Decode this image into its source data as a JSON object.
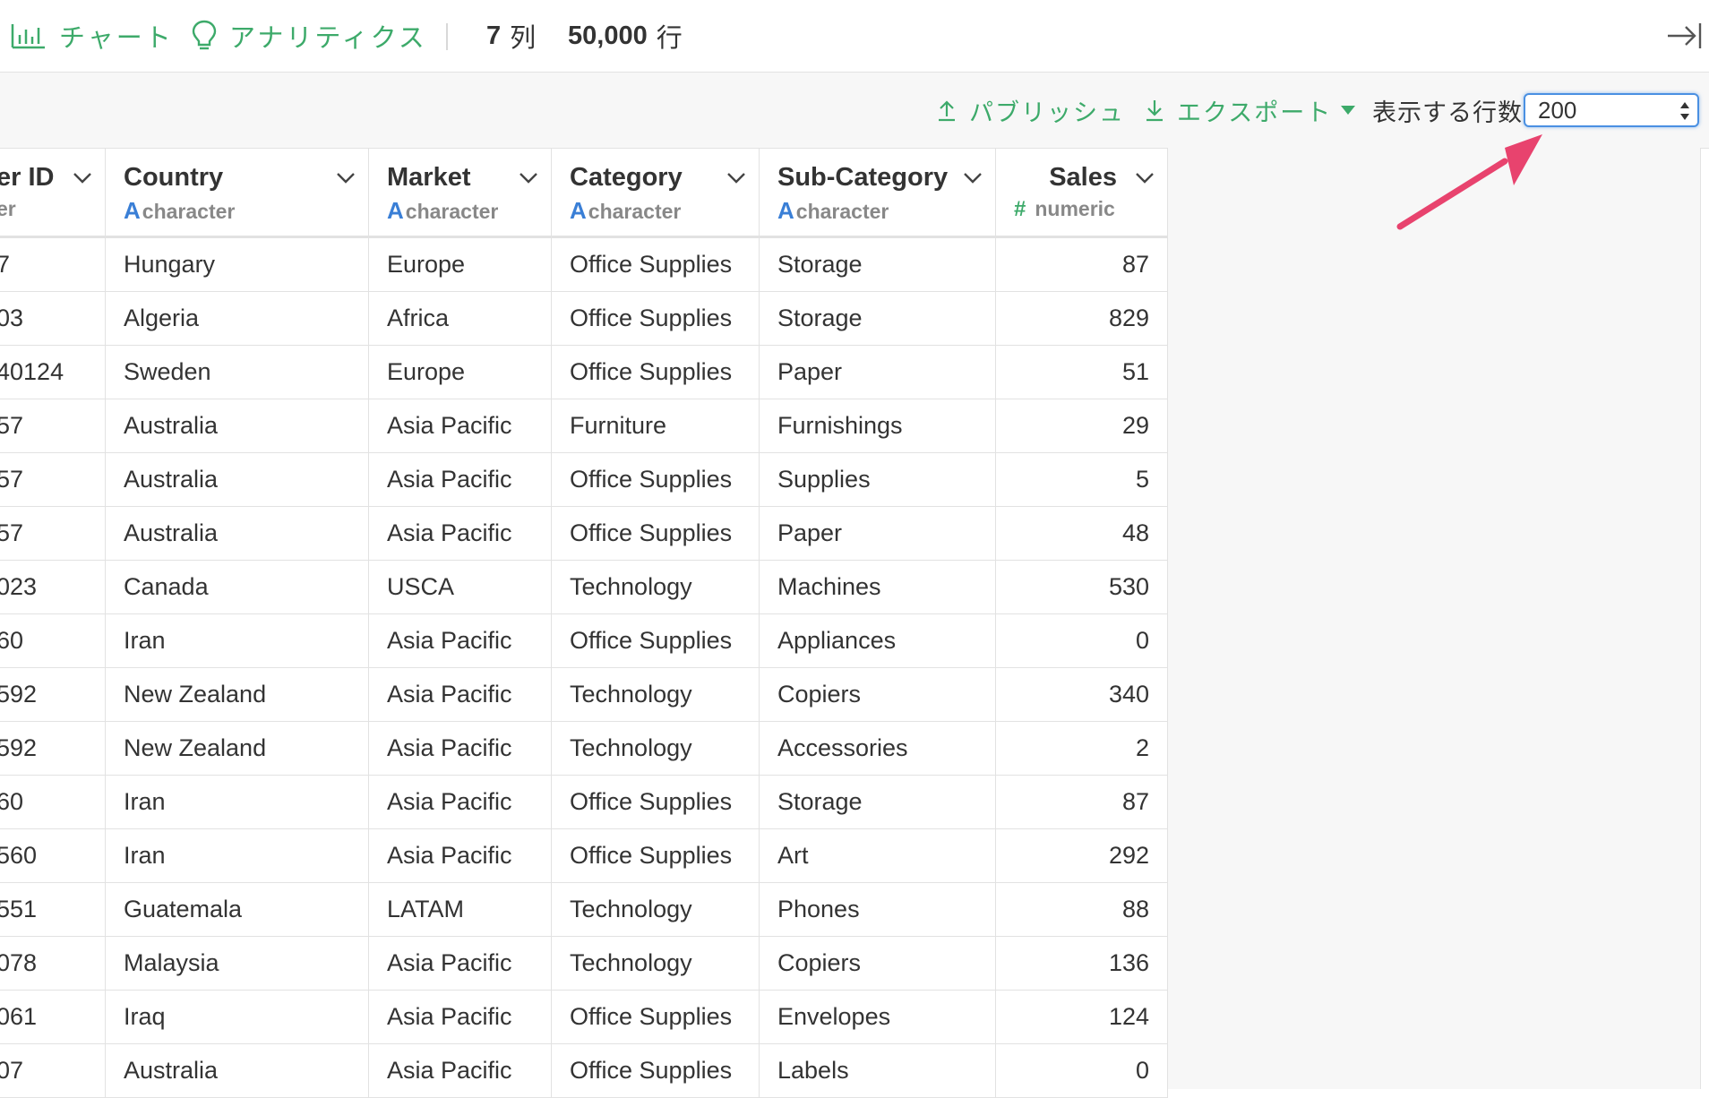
{
  "toolbar": {
    "chart_label": "チャート",
    "analytics_label": "アナリティクス",
    "columns_count": "7",
    "columns_unit": "列",
    "rows_count": "50,000",
    "rows_unit": "行"
  },
  "subbar": {
    "publish_label": "パブリッシュ",
    "export_label": "エクスポート",
    "rows_display_label": "表示する行数",
    "rows_display_value": "200"
  },
  "colors": {
    "accent_green": "#3daa6a",
    "type_blue": "#3a7fd6",
    "arrow_pink": "#e8436e",
    "focus_blue": "#4a90e2"
  },
  "columns": [
    {
      "name": "er ID",
      "type": "er"
    },
    {
      "name": "Country",
      "type_icon": "A",
      "type": "character"
    },
    {
      "name": "Market",
      "type_icon": "A",
      "type": "character"
    },
    {
      "name": "Category",
      "type_icon": "A",
      "type": "character"
    },
    {
      "name": "Sub-Category",
      "type_icon": "A",
      "type": "character"
    },
    {
      "name": "Sales",
      "type_icon": "#",
      "type": "numeric"
    }
  ],
  "rows": [
    [
      "7",
      "Hungary",
      "Europe",
      "Office Supplies",
      "Storage",
      "87"
    ],
    [
      "03",
      "Algeria",
      "Africa",
      "Office Supplies",
      "Storage",
      "829"
    ],
    [
      "40124",
      "Sweden",
      "Europe",
      "Office Supplies",
      "Paper",
      "51"
    ],
    [
      "57",
      "Australia",
      "Asia Pacific",
      "Furniture",
      "Furnishings",
      "29"
    ],
    [
      "57",
      "Australia",
      "Asia Pacific",
      "Office Supplies",
      "Supplies",
      "5"
    ],
    [
      "57",
      "Australia",
      "Asia Pacific",
      "Office Supplies",
      "Paper",
      "48"
    ],
    [
      "023",
      "Canada",
      "USCA",
      "Technology",
      "Machines",
      "530"
    ],
    [
      "60",
      "Iran",
      "Asia Pacific",
      "Office Supplies",
      "Appliances",
      "0"
    ],
    [
      "592",
      "New Zealand",
      "Asia Pacific",
      "Technology",
      "Copiers",
      "340"
    ],
    [
      "592",
      "New Zealand",
      "Asia Pacific",
      "Technology",
      "Accessories",
      "2"
    ],
    [
      "60",
      "Iran",
      "Asia Pacific",
      "Office Supplies",
      "Storage",
      "87"
    ],
    [
      "560",
      "Iran",
      "Asia Pacific",
      "Office Supplies",
      "Art",
      "292"
    ],
    [
      "551",
      "Guatemala",
      "LATAM",
      "Technology",
      "Phones",
      "88"
    ],
    [
      "078",
      "Malaysia",
      "Asia Pacific",
      "Technology",
      "Copiers",
      "136"
    ],
    [
      "061",
      "Iraq",
      "Asia Pacific",
      "Office Supplies",
      "Envelopes",
      "124"
    ],
    [
      "07",
      "Australia",
      "Asia Pacific",
      "Office Supplies",
      "Labels",
      "0"
    ]
  ]
}
